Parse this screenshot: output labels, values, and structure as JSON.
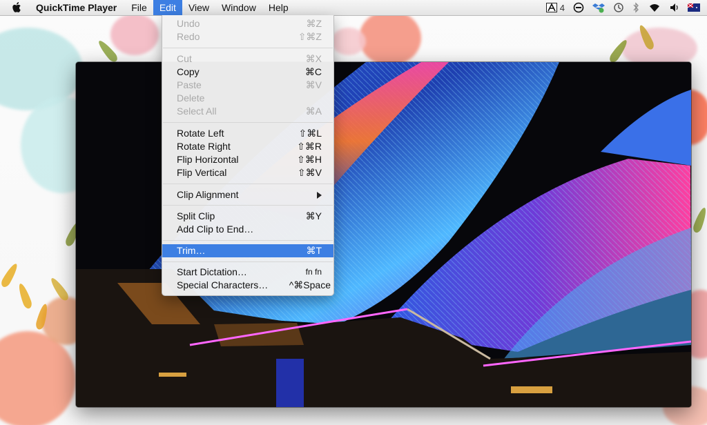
{
  "menubar": {
    "app_name": "QuickTime Player",
    "menus": [
      "File",
      "Edit",
      "View",
      "Window",
      "Help"
    ],
    "active_menu": "Edit",
    "status": {
      "adobe_badge": "4",
      "icons": [
        "adobe-icon",
        "no-entry-icon",
        "dropbox-sync-icon",
        "time-machine-icon",
        "bluetooth-icon",
        "wifi-icon",
        "volume-icon",
        "flag-icon"
      ]
    }
  },
  "edit_menu": {
    "items": [
      {
        "label": "Undo",
        "shortcut": "⌘Z",
        "enabled": false
      },
      {
        "label": "Redo",
        "shortcut": "⇧⌘Z",
        "enabled": false
      },
      {
        "label": "Cut",
        "shortcut": "⌘X",
        "enabled": false
      },
      {
        "label": "Copy",
        "shortcut": "⌘C",
        "enabled": true
      },
      {
        "label": "Paste",
        "shortcut": "⌘V",
        "enabled": false
      },
      {
        "label": "Delete",
        "shortcut": "",
        "enabled": false
      },
      {
        "label": "Select All",
        "shortcut": "⌘A",
        "enabled": false
      },
      {
        "label": "Rotate Left",
        "shortcut": "⇧⌘L",
        "enabled": true
      },
      {
        "label": "Rotate Right",
        "shortcut": "⇧⌘R",
        "enabled": true
      },
      {
        "label": "Flip Horizontal",
        "shortcut": "⇧⌘H",
        "enabled": true
      },
      {
        "label": "Flip Vertical",
        "shortcut": "⇧⌘V",
        "enabled": true
      },
      {
        "label": "Clip Alignment",
        "shortcut": "",
        "enabled": true,
        "submenu": true
      },
      {
        "label": "Split Clip",
        "shortcut": "⌘Y",
        "enabled": true
      },
      {
        "label": "Add Clip to End…",
        "shortcut": "",
        "enabled": true
      },
      {
        "label": "Trim…",
        "shortcut": "⌘T",
        "enabled": true,
        "selected": true
      },
      {
        "label": "Start Dictation…",
        "shortcut": "fn fn",
        "enabled": true
      },
      {
        "label": "Special Characters…",
        "shortcut": "^⌘Space",
        "enabled": true
      }
    ]
  },
  "colors": {
    "menu_highlight": "#3d7fe3",
    "disabled_text": "#a9a9a9"
  }
}
